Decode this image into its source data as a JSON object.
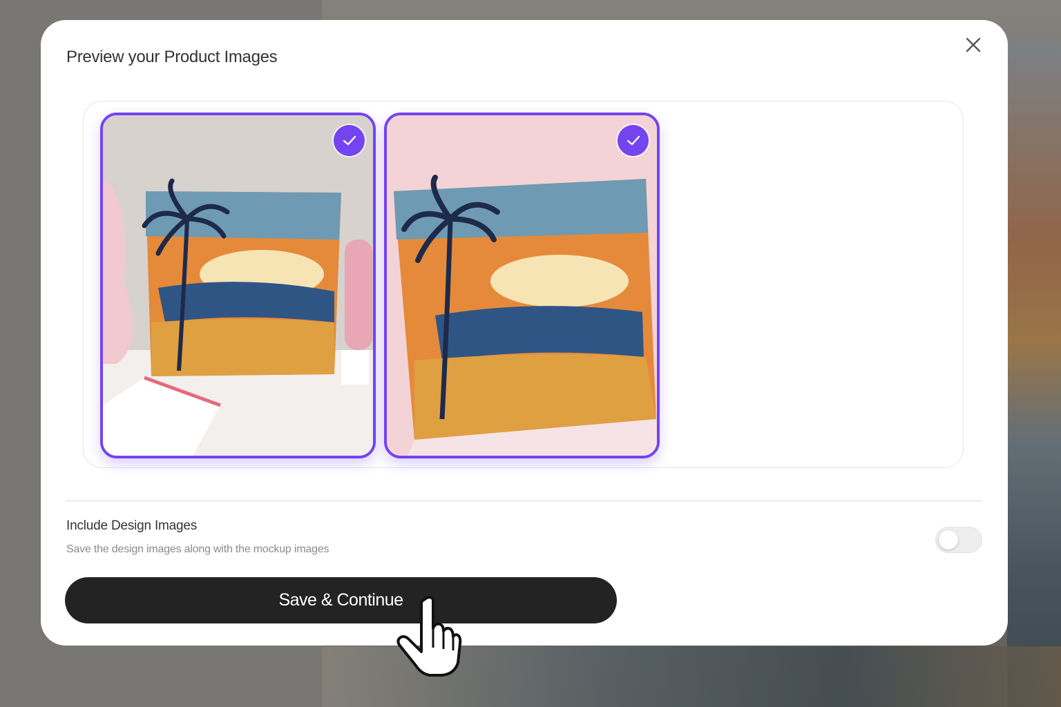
{
  "modal": {
    "title": "Preview your Product Images",
    "close_icon": "close-icon"
  },
  "gallery": {
    "images": [
      {
        "name": "pillow-mockup-living-room",
        "selected": true,
        "icon": "check-icon"
      },
      {
        "name": "pillow-mockup-held-pink",
        "selected": true,
        "icon": "check-icon"
      }
    ]
  },
  "options": {
    "include_design_images": {
      "label": "Include Design Images",
      "description": "Save the design images along with the mockup images",
      "enabled": false
    }
  },
  "actions": {
    "save_label": "Save & Continue"
  },
  "colors": {
    "accent": "#7444f0",
    "button_bg": "#232323",
    "toggle_off": "#eeeeef"
  },
  "cursor": {
    "icon": "hand-pointer-icon"
  }
}
